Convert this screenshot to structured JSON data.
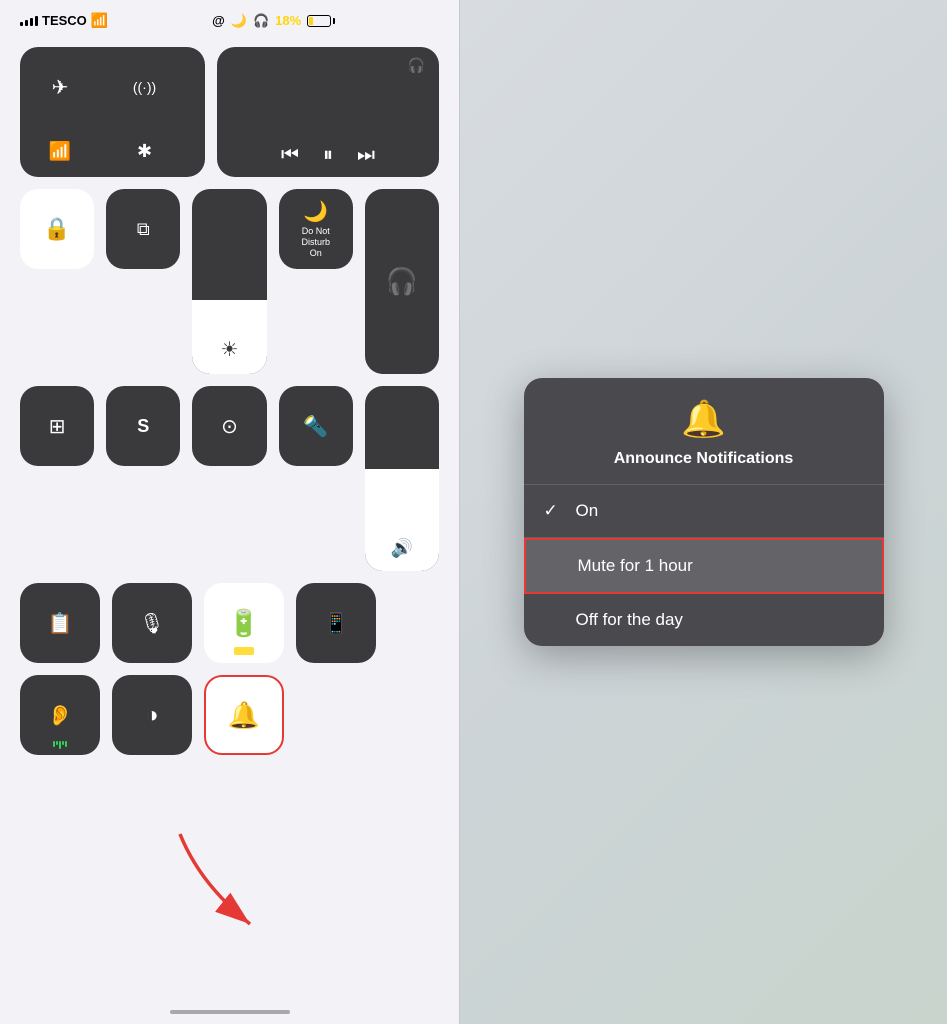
{
  "status_bar": {
    "carrier": "TESCO",
    "wifi": true,
    "time_center": "@",
    "moon": "🌙",
    "headphone": "🎧",
    "battery_percent": "18%",
    "battery_color": "#ffd60a"
  },
  "control_center": {
    "connectivity": {
      "airplane_label": "✈",
      "cellular_label": "((·))",
      "wifi_label": "WiFi",
      "bluetooth_label": "BT"
    },
    "media": {
      "rewind": "«",
      "play": "▐▌",
      "forward": "»"
    },
    "tiles": [
      {
        "id": "screen-lock",
        "icon": "🔒",
        "bg": "white"
      },
      {
        "id": "screen-mirror",
        "icon": "⧉",
        "bg": "dark"
      },
      {
        "id": "do-not-disturb",
        "icon": "🌙",
        "label": "Do Not\nDisturb\nOn",
        "bg": "dark"
      },
      {
        "id": "calculator",
        "icon": "⊞",
        "bg": "dark"
      },
      {
        "id": "shazam",
        "icon": "S",
        "bg": "dark"
      },
      {
        "id": "screen-record",
        "icon": "⊙",
        "bg": "dark"
      },
      {
        "id": "flashlight",
        "icon": "🔦",
        "bg": "dark"
      },
      {
        "id": "notes",
        "icon": "📝",
        "bg": "dark"
      },
      {
        "id": "voice-memos",
        "icon": "🎙",
        "bg": "dark"
      },
      {
        "id": "battery-status",
        "icon": "🔋",
        "bg": "white"
      },
      {
        "id": "remote",
        "icon": "📱",
        "bg": "dark"
      },
      {
        "id": "hearing",
        "icon": "👂",
        "bg": "dark"
      },
      {
        "id": "dark-mode",
        "icon": "◑",
        "bg": "dark"
      },
      {
        "id": "announce-notifications",
        "icon": "🔔",
        "bg": "white",
        "highlighted": true
      }
    ]
  },
  "popup": {
    "icon": "🔔",
    "title": "Announce Notifications",
    "items": [
      {
        "id": "on",
        "text": "On",
        "checked": true
      },
      {
        "id": "mute-hour",
        "text": "Mute for 1 hour",
        "checked": false,
        "highlighted": true
      },
      {
        "id": "off-day",
        "text": "Off for the day",
        "checked": false
      }
    ]
  }
}
